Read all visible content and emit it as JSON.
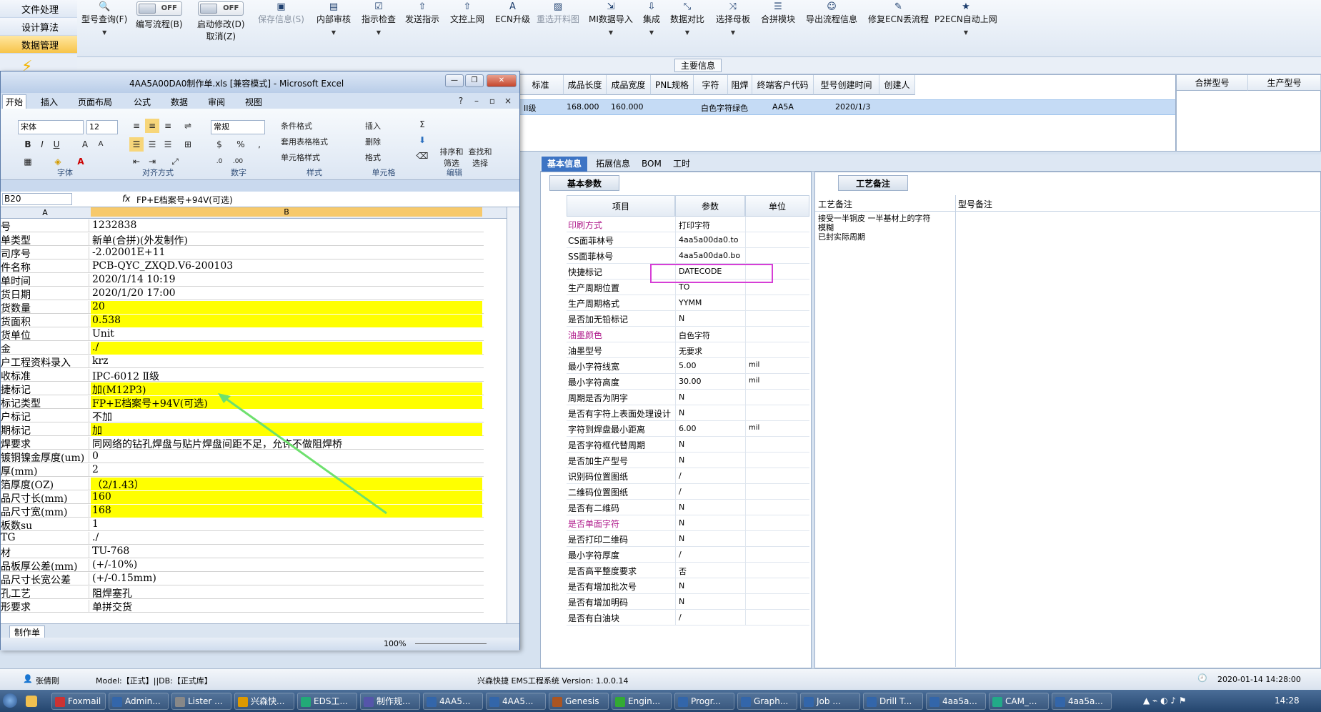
{
  "leftnav": {
    "items": [
      "文件处理",
      "设计算法",
      "数据管理"
    ]
  },
  "toolbar": {
    "model_query": "型号查询(F)",
    "write_flow": "编写流程(B)",
    "write_flow_toggle": "OFF",
    "auto_modify": "启动修改(D)",
    "auto_modify_cancel": "取消(Z)",
    "auto_modify_toggle": "OFF",
    "save_info": "保存信息(S)",
    "internal_review": "内部审核",
    "instruction_check": "指示检查",
    "send_instruction": "发送指示",
    "doc_upload": "文控上网",
    "ecn_upgrade": "ECN升级",
    "reopen_chart": "重选开料图",
    "mi_import": "MI数据导入",
    "integrate": "集成",
    "data_compare": "数据对比",
    "select_mother": "选择母板",
    "merge_module": "合拼模块",
    "export_flow": "导出流程信息",
    "fix_ecn": "修复ECN丢流程",
    "p2ecn": "P2ECN自动上网"
  },
  "main_info": {
    "label": "主要信息",
    "columns": [
      "标准",
      "成品长度",
      "成品宽度",
      "PNL规格",
      "字符",
      "阻焊",
      "终端客户代码",
      "型号创建时间",
      "创建人"
    ],
    "row": {
      "level": "II级",
      "length": "168.000",
      "width": "160.000",
      "char": "白色字符",
      "mask": "绿色",
      "customer": "AA5A",
      "created": "2020/1/3"
    },
    "right_columns": [
      "合拼型号",
      "生产型号"
    ]
  },
  "tabs": [
    "基本信息",
    "拓展信息",
    "BOM",
    "工时"
  ],
  "basic_params": {
    "subtab": "基本参数",
    "headers": [
      "项目",
      "参数",
      "单位"
    ],
    "rows": [
      {
        "k": "印刷方式",
        "v": "打印字符",
        "u": "",
        "pink": true
      },
      {
        "k": "CS面菲林号",
        "v": "4aa5a00da0.to",
        "u": ""
      },
      {
        "k": "SS面菲林号",
        "v": "4aa5a00da0.bo",
        "u": ""
      },
      {
        "k": "快捷标记",
        "v": "DATECODE",
        "u": ""
      },
      {
        "k": "生产周期位置",
        "v": "TO",
        "u": ""
      },
      {
        "k": "生产周期格式",
        "v": "YYMM",
        "u": ""
      },
      {
        "k": "是否加无铅标记",
        "v": "N",
        "u": ""
      },
      {
        "k": "油墨颜色",
        "v": "白色字符",
        "u": "",
        "pink": true
      },
      {
        "k": "油墨型号",
        "v": "无要求",
        "u": ""
      },
      {
        "k": "最小字符线宽",
        "v": "5.00",
        "u": "mil"
      },
      {
        "k": "最小字符高度",
        "v": "30.00",
        "u": "mil"
      },
      {
        "k": "周期是否为阴字",
        "v": "N",
        "u": ""
      },
      {
        "k": "是否有字符上表面处理设计",
        "v": "N",
        "u": ""
      },
      {
        "k": "字符到焊盘最小距离",
        "v": "6.00",
        "u": "mil"
      },
      {
        "k": "是否字符框代替周期",
        "v": "N",
        "u": ""
      },
      {
        "k": "是否加生产型号",
        "v": "N",
        "u": ""
      },
      {
        "k": "识别码位置图纸",
        "v": "/",
        "u": ""
      },
      {
        "k": "二维码位置图纸",
        "v": "/",
        "u": ""
      },
      {
        "k": "是否有二维码",
        "v": "N",
        "u": ""
      },
      {
        "k": "是否单面字符",
        "v": "N",
        "u": "",
        "pink": true
      },
      {
        "k": "是否打印二维码",
        "v": "N",
        "u": ""
      },
      {
        "k": "最小字符厚度",
        "v": "/",
        "u": ""
      },
      {
        "k": "是否高平整度要求",
        "v": "否",
        "u": ""
      },
      {
        "k": "是否有增加批次号",
        "v": "N",
        "u": ""
      },
      {
        "k": "是否有增加明码",
        "v": "N",
        "u": ""
      },
      {
        "k": "是否有白油块",
        "v": "/",
        "u": ""
      }
    ]
  },
  "process": {
    "subtab": "工艺备注",
    "col1": "工艺备注",
    "col2": "型号备注",
    "note_lines": [
      "接受一半铜皮 一半基材上的字符",
      "模糊",
      "已封实际周期"
    ]
  },
  "excel": {
    "title": "4AA5A00DA0制作单.xls [兼容模式] - Microsoft Excel",
    "tabs": [
      "开始",
      "插入",
      "页面布局",
      "公式",
      "数据",
      "审阅",
      "视图"
    ],
    "font": "宋体",
    "size": "12",
    "number_format": "常规",
    "groups": [
      "字体",
      "对齐方式",
      "数字",
      "样式",
      "单元格",
      "编辑"
    ],
    "styles": [
      "条件格式",
      "套用表格格式",
      "单元格样式"
    ],
    "cells": [
      "插入",
      "删除",
      "格式"
    ],
    "edit": [
      "排序和筛选",
      "查找和选择"
    ],
    "name_box": "B20",
    "formula": "FP+E档案号+94V(可选)",
    "col_a": "A",
    "col_b": "B",
    "rows": [
      {
        "a": "号",
        "b": "1232838",
        "y": false
      },
      {
        "a": "单类型",
        "b": "新单(合拼)(外发制作)",
        "y": false
      },
      {
        "a": "司序号",
        "b": "-2.02001E+11",
        "y": false
      },
      {
        "a": "件名称",
        "b": "PCB-QYC_ZXQD.V6-200103",
        "y": false
      },
      {
        "a": "单时间",
        "b": "2020/1/14 10:19",
        "y": false
      },
      {
        "a": "货日期",
        "b": "2020/1/20 17:00",
        "y": false
      },
      {
        "a": "货数量",
        "b": "20",
        "y": true
      },
      {
        "a": "货面积",
        "b": "0.538",
        "y": true
      },
      {
        "a": "货单位",
        "b": "Unit",
        "y": false
      },
      {
        "a": "金",
        "b": "./",
        "y": true
      },
      {
        "a": "户工程资料录入",
        "b": "krz",
        "y": false
      },
      {
        "a": "收标准",
        "b": "IPC-6012 Ⅱ级",
        "y": false
      },
      {
        "a": "捷标记",
        "b": "加(M12P3)",
        "y": true
      },
      {
        "a": "标记类型",
        "b": "FP+E档案号+94V(可选)",
        "y": true
      },
      {
        "a": "户标记",
        "b": "不加",
        "y": false
      },
      {
        "a": "期标记",
        "b": "加",
        "y": true
      },
      {
        "a": "焊要求",
        "b": "同网络的钻孔焊盘与贴片焊盘间距不足，允许不做阻焊桥",
        "y": false
      },
      {
        "a": "镀铜镍金厚度(um)",
        "b": "0",
        "y": false
      },
      {
        "a": "厚(mm)",
        "b": "2",
        "y": false
      },
      {
        "a": "箔厚度(OZ)",
        "b": "（2/1.43）",
        "y": true
      },
      {
        "a": "品尺寸长(mm)",
        "b": "160",
        "y": true
      },
      {
        "a": "品尺寸宽(mm)",
        "b": "168",
        "y": true
      },
      {
        "a": "板数su",
        "b": "1",
        "y": false
      },
      {
        "a": "TG",
        "b": "./",
        "y": false
      },
      {
        "a": "材",
        "b": "TU-768",
        "y": false
      },
      {
        "a": "品板厚公差(mm)",
        "b": "(+/-10%)",
        "y": false
      },
      {
        "a": "品尺寸长宽公差",
        "b": "(+/-0.15mm)",
        "y": false
      },
      {
        "a": "孔工艺",
        "b": "阻焊塞孔",
        "y": false
      },
      {
        "a": "形要求",
        "b": "单拼交货",
        "y": false
      }
    ],
    "sheet_tab": "制作单",
    "zoom": "100%"
  },
  "status": {
    "user": "张倩刚",
    "model": "Model:【正式】||DB:【正式库】",
    "system": "兴森快捷 EMS工程系统 Version: 1.0.0.14",
    "datetime": "2020-01-14 14:28:00"
  },
  "taskbar": {
    "items": [
      "Foxmail",
      "Admin...",
      "Lister ...",
      "兴森快...",
      "EDS工...",
      "制作规...",
      "4AA5...",
      "4AA5...",
      "Genesis",
      "Engin...",
      "Progr...",
      "Graph...",
      "Job ...",
      "Drill T...",
      "4aa5a...",
      "CAM_...",
      "4aa5a..."
    ],
    "clock": "14:28"
  },
  "colors": {
    "accent": "#3d74c4",
    "yellow": "#ffff00",
    "highlight": "#d63fd6",
    "pink": "#b01d8c"
  }
}
